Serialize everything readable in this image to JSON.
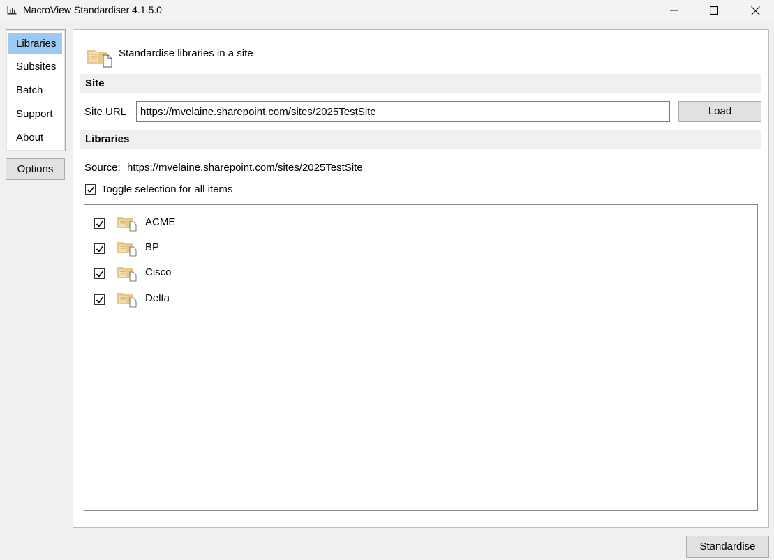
{
  "window": {
    "title": "MacroView Standardiser 4.1.5.0"
  },
  "nav": {
    "items": [
      {
        "label": "Libraries"
      },
      {
        "label": "Subsites"
      },
      {
        "label": "Batch"
      },
      {
        "label": "Support"
      },
      {
        "label": "About"
      }
    ],
    "options_label": "Options"
  },
  "main": {
    "heading": "Standardise libraries in a site",
    "site_section_title": "Site",
    "site_url_label": "Site URL",
    "site_url_value": "https://mvelaine.sharepoint.com/sites/2025TestSite",
    "load_label": "Load",
    "libraries_section_title": "Libraries",
    "source_label": "Source:",
    "source_value": "https://mvelaine.sharepoint.com/sites/2025TestSite",
    "toggle_all_label": "Toggle selection for all items",
    "libraries": [
      {
        "name": "ACME",
        "checked": true
      },
      {
        "name": "BP",
        "checked": true
      },
      {
        "name": "Cisco",
        "checked": true
      },
      {
        "name": "Delta",
        "checked": true
      }
    ]
  },
  "footer": {
    "standardise_label": "Standardise"
  },
  "colors": {
    "nav_selected": "#9ccaf2",
    "folder_icon": "#e8c98a",
    "button_face": "#e1e1e1"
  }
}
